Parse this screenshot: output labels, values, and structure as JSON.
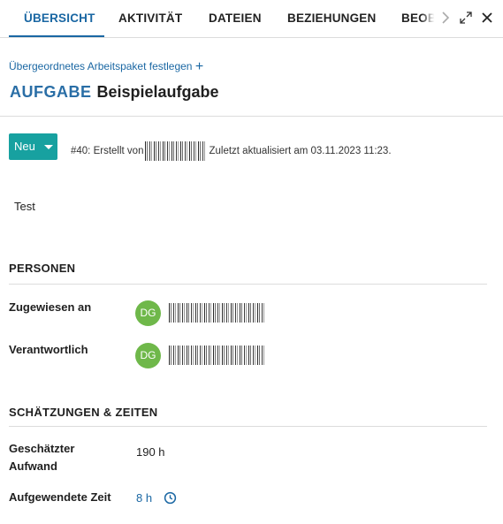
{
  "tabs": [
    {
      "label": "ÜBERSICHT",
      "active": true
    },
    {
      "label": "AKTIVITÄT",
      "active": false
    },
    {
      "label": "DATEIEN",
      "active": false
    },
    {
      "label": "BEZIEHUNGEN",
      "active": false
    },
    {
      "label": "BEOBACHTER",
      "active": false
    }
  ],
  "header_icons": [
    "chevron-right-icon",
    "expand-icon",
    "close-icon"
  ],
  "parent_link": {
    "label": "Übergeordnetes Arbeitspaket festlegen",
    "icon": "+"
  },
  "work_package": {
    "type": "AUFGABE",
    "subject": "Beispielaufgabe",
    "status": "Neu",
    "meta_prefix": "#40: Erstellt von",
    "meta_suffix": "Zuletzt aktualisiert am 03.11.2023 11:23.",
    "description": "Test"
  },
  "people": {
    "title": "PERSONEN",
    "assignee_label": "Zugewiesen an",
    "assignee_initials": "DG",
    "responsible_label": "Verantwortlich",
    "responsible_initials": "DG"
  },
  "estimates": {
    "title": "SCHÄTZUNGEN & ZEITEN",
    "estimated_label_1": "Geschätzter",
    "estimated_label_2": "Aufwand",
    "estimated_value": "190 h",
    "spent_label": "Aufgewendete Zeit",
    "spent_value": "8 h"
  },
  "colors": {
    "accent": "#1a67a3",
    "status": "#17a1a0",
    "avatar": "#6fb84a"
  }
}
